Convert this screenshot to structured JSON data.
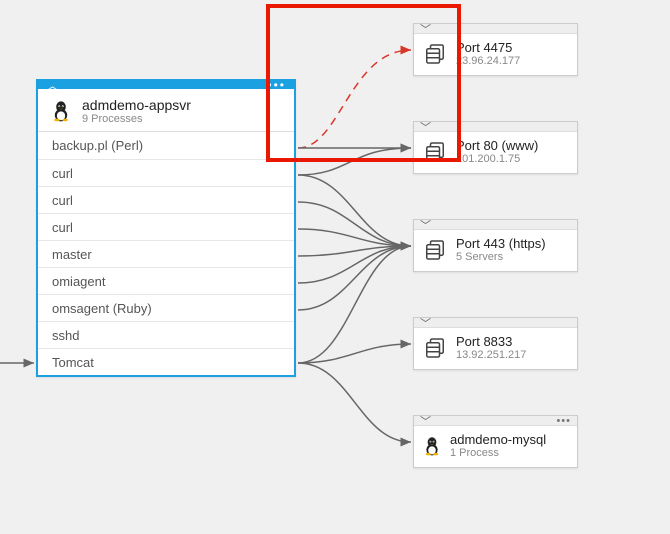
{
  "server": {
    "name": "admdemo-appsvr",
    "subtitle": "9 Processes",
    "processes": [
      "backup.pl (Perl)",
      "curl",
      "curl",
      "curl",
      "master",
      "omiagent",
      "omsagent (Ruby)",
      "sshd",
      "Tomcat"
    ]
  },
  "ports": [
    {
      "name": "Port 4475",
      "sub": "23.96.24.177",
      "icon": "servers"
    },
    {
      "name": "Port 80 (www)",
      "sub": "101.200.1.75",
      "icon": "servers"
    },
    {
      "name": "Port 443 (https)",
      "sub": "5 Servers",
      "icon": "servers"
    },
    {
      "name": "Port 8833",
      "sub": "13.92.251.217",
      "icon": "servers"
    },
    {
      "name": "admdemo-mysql",
      "sub": "1 Process",
      "icon": "penguin"
    }
  ],
  "chart_data": {
    "type": "diagram",
    "nodes": [
      {
        "id": "admdemo-appsvr",
        "type": "server",
        "processes": [
          "backup.pl (Perl)",
          "curl",
          "curl",
          "curl",
          "master",
          "omiagent",
          "omsagent (Ruby)",
          "sshd",
          "Tomcat"
        ]
      },
      {
        "id": "Port 4475",
        "type": "port-group",
        "sub": "23.96.24.177"
      },
      {
        "id": "Port 80 (www)",
        "type": "port-group",
        "sub": "101.200.1.75"
      },
      {
        "id": "Port 443 (https)",
        "type": "port-group",
        "sub": "5 Servers"
      },
      {
        "id": "Port 8833",
        "type": "port-group",
        "sub": "13.92.251.217"
      },
      {
        "id": "admdemo-mysql",
        "type": "server",
        "sub": "1 Process"
      }
    ],
    "edges": [
      {
        "from": "(external)",
        "to": "Tomcat"
      },
      {
        "from": "backup.pl (Perl)",
        "to": "Port 4475",
        "style": "dashed",
        "status": "failed"
      },
      {
        "from": "backup.pl (Perl)",
        "to": "Port 80 (www)"
      },
      {
        "from": "curl",
        "to": "Port 80 (www)"
      },
      {
        "from": "curl",
        "to": "Port 443 (https)"
      },
      {
        "from": "curl",
        "to": "Port 443 (https)"
      },
      {
        "from": "curl",
        "to": "Port 443 (https)"
      },
      {
        "from": "master",
        "to": "Port 443 (https)"
      },
      {
        "from": "omiagent",
        "to": "Port 443 (https)"
      },
      {
        "from": "omsagent (Ruby)",
        "to": "Port 443 (https)"
      },
      {
        "from": "Tomcat",
        "to": "Port 443 (https)"
      },
      {
        "from": "Tomcat",
        "to": "Port 8833"
      },
      {
        "from": "Tomcat",
        "to": "admdemo-mysql"
      }
    ],
    "highlight": {
      "description": "Failed/dashed connection from backup.pl to Port 4475 highlighted with red rectangle"
    }
  }
}
